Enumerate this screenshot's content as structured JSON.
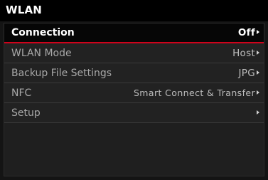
{
  "header": {
    "title": "WLAN"
  },
  "menu": {
    "items": [
      {
        "label": "Connection",
        "value": "Off",
        "icon": "chevron-right-icon"
      },
      {
        "label": "WLAN Mode",
        "value": "Host",
        "icon": "chevron-right-icon"
      },
      {
        "label": "Backup File Settings",
        "value": "JPG",
        "icon": "chevron-right-icon"
      },
      {
        "label": "NFC",
        "value": "Smart Connect & Transfer",
        "icon": "chevron-right-icon"
      },
      {
        "label": "Setup",
        "value": "",
        "icon": "chevron-right-icon"
      }
    ]
  },
  "colors": {
    "accent": "#d0021b",
    "background": "#141414",
    "title_bar": "#000000"
  }
}
